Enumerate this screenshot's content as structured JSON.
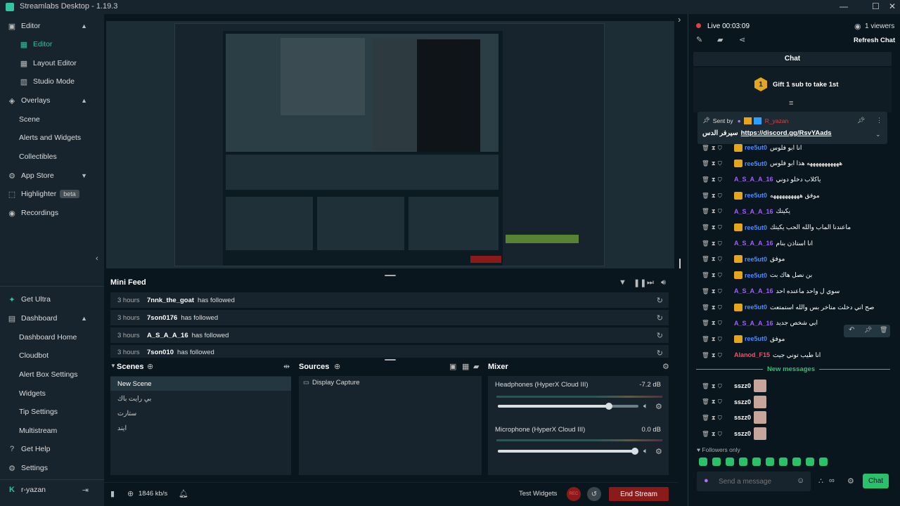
{
  "app": {
    "title": "Streamlabs Desktop - 1.19.3"
  },
  "nav": {
    "editor": "Editor",
    "editor_sub": "Editor",
    "layout_editor": "Layout Editor",
    "studio_mode": "Studio Mode",
    "overlays": "Overlays",
    "scene": "Scene",
    "alerts_widgets": "Alerts and Widgets",
    "collectibles": "Collectibles",
    "app_store": "App Store",
    "highlighter": "Highlighter",
    "highlighter_badge": "beta",
    "recordings": "Recordings",
    "get_ultra": "Get Ultra",
    "dashboard": "Dashboard",
    "dashboard_home": "Dashboard Home",
    "cloudbot": "Cloudbot",
    "alert_box": "Alert Box Settings",
    "widgets": "Widgets",
    "tip_settings": "Tip Settings",
    "multistream": "Multistream",
    "get_help": "Get Help",
    "settings": "Settings",
    "user": "r-yazan"
  },
  "minifeed": {
    "title": "Mini Feed",
    "rows": [
      {
        "time": "3 hours",
        "user": "7nnk_the_goat",
        "action": "has followed"
      },
      {
        "time": "3 hours",
        "user": "7son0176",
        "action": "has followed"
      },
      {
        "time": "3 hours",
        "user": "A_S_A_A_16",
        "action": "has followed"
      },
      {
        "time": "3 hours",
        "user": "7son010",
        "action": "has followed"
      }
    ]
  },
  "scenes": {
    "title": "Scenes",
    "items": [
      "New Scene",
      "بي رايت باك",
      "ستارت",
      "ايند"
    ]
  },
  "sources": {
    "title": "Sources",
    "items": [
      "Display Capture"
    ]
  },
  "mixer": {
    "title": "Mixer",
    "channels": [
      {
        "name": "Headphones (HyperX Cloud III)",
        "db": "-7.2 dB",
        "level": 0.79
      },
      {
        "name": "Microphone (HyperX Cloud III)",
        "db": "0.0 dB",
        "level": 1.0
      }
    ]
  },
  "footer": {
    "bitrate": "1846 kb/s",
    "test_widgets": "Test Widgets",
    "rec": "REC",
    "end_stream": "End Stream"
  },
  "live": {
    "status": "Live 00:03:09",
    "viewers": "1 viewers",
    "refresh": "Refresh Chat"
  },
  "chat": {
    "title": "Chat",
    "gift": "Gift 1 sub to take 1st",
    "gift_rank": "1",
    "pinned_by": "Sent by",
    "pinned_user": "R_yazan",
    "pinned_msg_prefix": "سيرفر الدس",
    "pinned_link": "https://discord.gg/RsvYAads",
    "messages": [
      {
        "user": "ree5ut0",
        "color": "#4a8cff",
        "text": "انا ابو فلوس",
        "crown": true
      },
      {
        "user": "ree5ut0",
        "color": "#4a8cff",
        "text": "هههههههههههه هذا ابو فلوس",
        "crown": true
      },
      {
        "user": "A_S_A_A_16",
        "color": "#a45cff",
        "text": "ياكلاب دخلو دوني",
        "crown": false
      },
      {
        "user": "ree5ut0",
        "color": "#4a8cff",
        "text": "موفق ههههههههههه",
        "crown": true
      },
      {
        "user": "A_S_A_A_16",
        "color": "#a45cff",
        "text": "يكيتك",
        "crown": false
      },
      {
        "user": "ree5ut0",
        "color": "#4a8cff",
        "text": "ماعندنا الماب والله الحب يكيتك",
        "crown": true
      },
      {
        "user": "A_S_A_A_16",
        "color": "#a45cff",
        "text": "انا استاذن بنام",
        "crown": false
      },
      {
        "user": "ree5ut0",
        "color": "#4a8cff",
        "text": "موفق",
        "crown": true
      },
      {
        "user": "ree5ut0",
        "color": "#4a8cff",
        "text": "بن نصل هاك بت",
        "crown": true
      },
      {
        "user": "A_S_A_A_16",
        "color": "#a45cff",
        "text": "سوي ل واحد ماعنده احد",
        "crown": false
      },
      {
        "user": "ree5ut0",
        "color": "#4a8cff",
        "text": "صح اني دخلت متاخر بس والله استمتعت",
        "crown": true
      },
      {
        "user": "A_S_A_A_16",
        "color": "#a45cff",
        "text": "ابي شخص جديد",
        "crown": false
      },
      {
        "user": "ree5ut0",
        "color": "#4a8cff",
        "text": "موفق",
        "crown": true
      },
      {
        "user": "Alanod_F15",
        "color": "#ff4a6a",
        "text": "انا طيب توني جيت",
        "crown": false
      }
    ],
    "new_messages": "New messages",
    "new": [
      {
        "user": "sszz0"
      },
      {
        "user": "sszz0"
      },
      {
        "user": "sszz0"
      },
      {
        "user": "sszz0"
      }
    ],
    "followers_only": "Followers only",
    "input_placeholder": "Send a message",
    "send": "Chat"
  }
}
